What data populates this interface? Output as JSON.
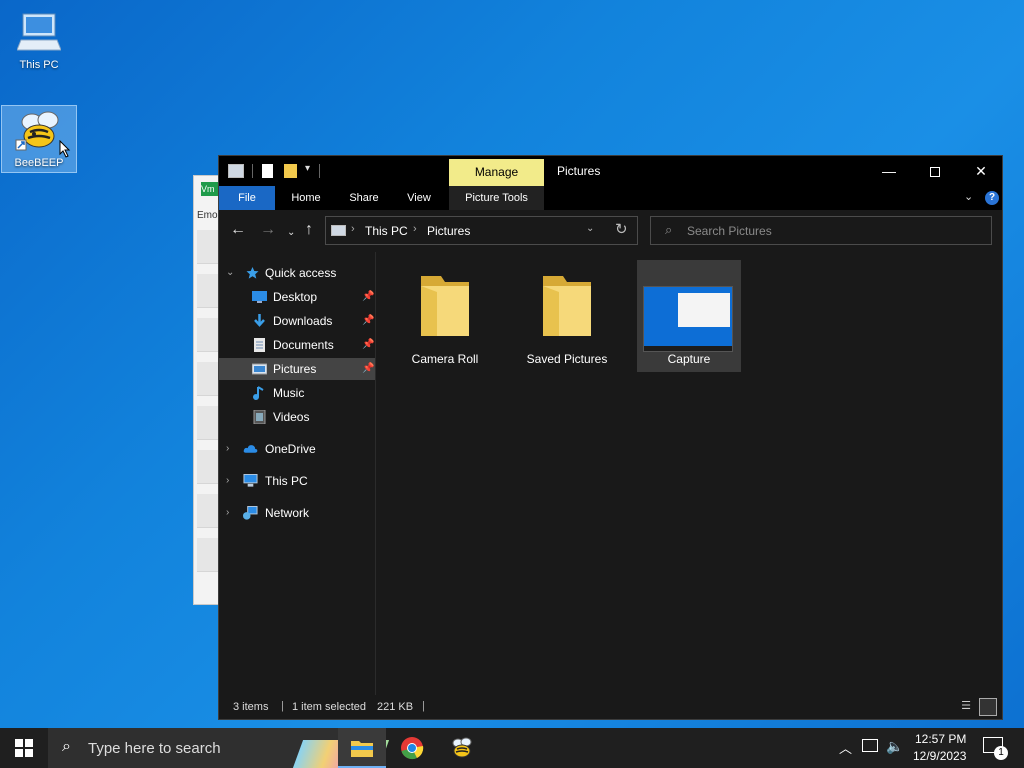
{
  "desktop": {
    "icons": [
      {
        "label": "This PC"
      },
      {
        "label": "BeeBEEP"
      }
    ]
  },
  "background_window": {
    "badge": "Vm",
    "partial_text": "Emo"
  },
  "explorer": {
    "title": "Pictures",
    "context_tab": "Manage",
    "ribbon_tabs": {
      "file": "File",
      "home": "Home",
      "share": "Share",
      "view": "View",
      "picture_tools": "Picture Tools"
    },
    "address": {
      "crumbs": [
        "This PC",
        "Pictures"
      ]
    },
    "search": {
      "placeholder": "Search Pictures"
    },
    "nav_pane": {
      "quick_access": "Quick access",
      "quick_items": [
        {
          "label": "Desktop",
          "pinned": true
        },
        {
          "label": "Downloads",
          "pinned": true
        },
        {
          "label": "Documents",
          "pinned": true
        },
        {
          "label": "Pictures",
          "pinned": true,
          "selected": true
        },
        {
          "label": "Music"
        },
        {
          "label": "Videos"
        }
      ],
      "roots": [
        {
          "label": "OneDrive"
        },
        {
          "label": "This PC"
        },
        {
          "label": "Network"
        }
      ]
    },
    "items": [
      {
        "label": "Camera Roll",
        "kind": "folder"
      },
      {
        "label": "Saved Pictures",
        "kind": "folder"
      },
      {
        "label": "Capture",
        "kind": "image",
        "selected": true
      }
    ],
    "status": {
      "count": "3 items",
      "selection": "1 item selected",
      "size": "221 KB"
    }
  },
  "taskbar": {
    "search_placeholder": "Type here to search",
    "clock": {
      "time": "12:57 PM",
      "date": "12/9/2023"
    },
    "notification_count": "1"
  },
  "colors": {
    "desktop_blue": "#1283dc",
    "explorer_bg": "#191919",
    "file_tab": "#1a68c5",
    "manage_tab": "#f2eb8a",
    "folder_yellow": "#f2c94c"
  }
}
